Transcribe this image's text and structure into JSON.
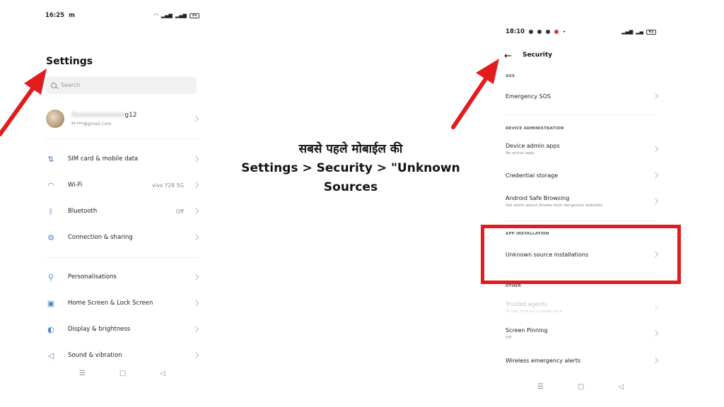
{
  "left_phone": {
    "status": {
      "time": "16:25",
      "carrier_glyph": "m",
      "battery": "31"
    },
    "title": "Settings",
    "search": {
      "placeholder": "Search"
    },
    "account": {
      "name_visible": "g12",
      "email": "Pr***@gmail.com"
    },
    "rows": [
      {
        "label": "SIM card & mobile data",
        "value": "",
        "icon": "sim-data-icon",
        "glyph": "⇅"
      },
      {
        "label": "Wi-Fi",
        "value": "vivo Y28 5G",
        "icon": "wifi-icon",
        "glyph": "◠"
      },
      {
        "label": "Bluetooth",
        "value": "Off",
        "icon": "bluetooth-icon",
        "glyph": "ᛒ"
      },
      {
        "label": "Connection & sharing",
        "value": "",
        "icon": "connection-sharing-icon",
        "glyph": "⚙"
      },
      {
        "label": "Personalisations",
        "value": "",
        "icon": "personalisation-icon",
        "glyph": "⚲"
      },
      {
        "label": "Home Screen & Lock Screen",
        "value": "",
        "icon": "home-lock-screen-icon",
        "glyph": "▣"
      },
      {
        "label": "Display & brightness",
        "value": "",
        "icon": "display-brightness-icon",
        "glyph": "◐"
      },
      {
        "label": "Sound & vibration",
        "value": "",
        "icon": "sound-vibration-icon",
        "glyph": "◁"
      }
    ],
    "nav": {
      "menu": "☰",
      "home": "▢",
      "back": "◁"
    }
  },
  "right_phone": {
    "status": {
      "time": "18:10",
      "battery": "61"
    },
    "title": "Security",
    "sections": {
      "sos": "SOS",
      "device_admin": "DEVICE ADMINISTRATION",
      "app_install": "APP INSTALLATION",
      "other": "OTHER"
    },
    "items": {
      "emergency_sos": {
        "label": "Emergency SOS"
      },
      "device_admin_apps": {
        "label": "Device admin apps",
        "sub": "No active apps"
      },
      "credential_storage": {
        "label": "Credential storage"
      },
      "safe_browsing": {
        "label": "Android Safe Browsing",
        "sub": "Get alerts about threats from dangerous websites"
      },
      "unknown_sources": {
        "label": "Unknown source installations"
      },
      "trusted_agents": {
        "label": "Trusted agents",
        "sub": "To use, first set a screen lock"
      },
      "screen_pinning": {
        "label": "Screen Pinning",
        "sub": "Off"
      },
      "emergency_alerts": {
        "label": "Wireless emergency alerts"
      }
    },
    "nav": {
      "menu": "☰",
      "home": "▢",
      "back": "◁"
    }
  },
  "caption": {
    "line1": "सबसे पहले मोबाईल की",
    "line2": "Settings > Security > \"Unknown",
    "line3": "Sources"
  },
  "colors": {
    "highlight": "#e21c1c",
    "arrow": "#e21c1c",
    "icon_accent": "#4a86c8"
  }
}
